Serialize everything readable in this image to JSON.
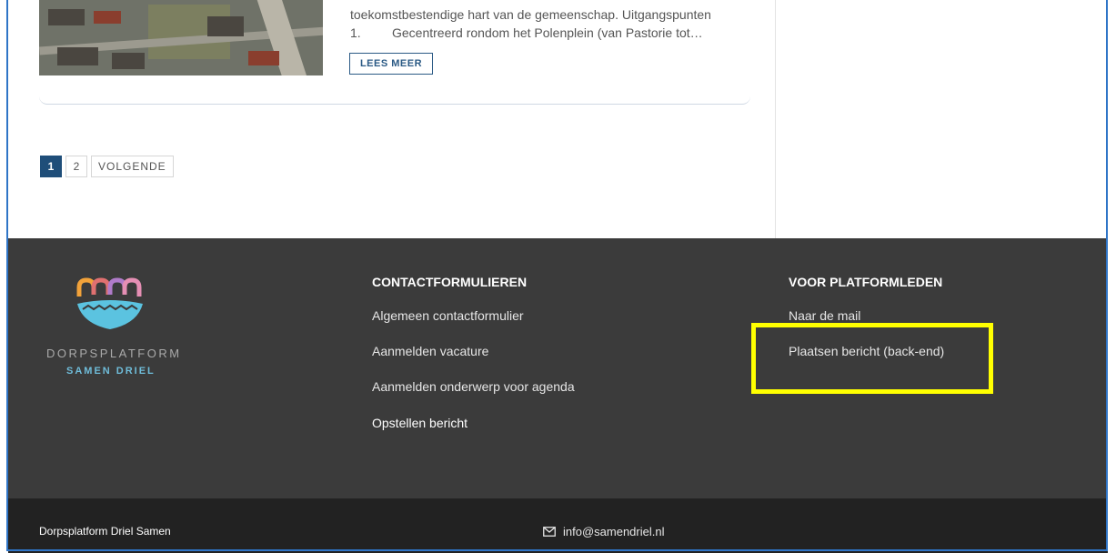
{
  "article": {
    "excerpt_line1": "toekomstbestendige hart van de gemeenschap.  Uitgangspunten",
    "excerpt_num": "1.",
    "excerpt_line2": "Gecentreerd rondom het Polenplein (van Pastorie tot…",
    "read_more": "LEES MEER"
  },
  "pagination": {
    "pages": [
      "1",
      "2"
    ],
    "active": "1",
    "next": "VOLGENDE"
  },
  "footer": {
    "logo": {
      "line1": "DORPSPLATFORM",
      "line2": "SAMEN DRIEL"
    },
    "contact": {
      "heading": "CONTACTFORMULIEREN",
      "links": [
        "Algemeen contactformulier",
        "Aanmelden vacature",
        "Aanmelden onderwerp voor agenda",
        "Opstellen bericht"
      ]
    },
    "members": {
      "heading": "VOOR PLATFORMLEDEN",
      "links": [
        "Naar de mail",
        "Plaatsen bericht (back-end)"
      ]
    }
  },
  "bottombar": {
    "copyright": "Dorpsplatform Driel Samen",
    "email": "info@samendriel.nl"
  },
  "colors": {
    "highlight": "#ffff00",
    "primary": "#1f4e79",
    "footer_bg": "#3b3b3b",
    "bottombar_bg": "#222222"
  }
}
